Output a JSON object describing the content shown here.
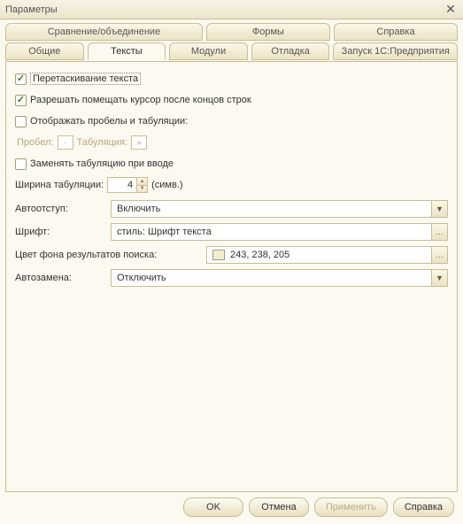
{
  "window": {
    "title": "Параметры"
  },
  "tabs_row1": [
    {
      "label": "Сравнение/объединение"
    },
    {
      "label": "Формы"
    },
    {
      "label": "Справка"
    }
  ],
  "tabs_row2": [
    {
      "label": "Общие"
    },
    {
      "label": "Тексты"
    },
    {
      "label": "Модули"
    },
    {
      "label": "Отладка"
    },
    {
      "label": "Запуск 1С:Предприятия"
    }
  ],
  "checks": {
    "drag_text": "Перетаскивание текста",
    "cursor_after_eol": "Разрешать помещать курсор после концов строк",
    "show_whitespace": "Отображать пробелы и табуляции:",
    "replace_tabs": "Заменять табуляцию при вводе"
  },
  "whitespace_row": {
    "space_label": "Пробел:",
    "space_char": "·",
    "tab_label": "Табуляция:",
    "tab_char": "»"
  },
  "tab_width": {
    "label": "Ширина табуляции:",
    "value": "4",
    "units": "(симв.)"
  },
  "fields": {
    "autoindent": {
      "label": "Автоотступ:",
      "value": "Включить"
    },
    "font": {
      "label": "Шрифт:",
      "value": "стиль: Шрифт текста"
    },
    "search_bg": {
      "label": "Цвет фона результатов поиска:",
      "value": "243, 238, 205",
      "swatch": "#f3eecd"
    },
    "autoreplace": {
      "label": "Автозамена:",
      "value": "Отключить"
    }
  },
  "buttons": {
    "ok": "OK",
    "cancel": "Отмена",
    "apply": "Применить",
    "help": "Справка"
  }
}
